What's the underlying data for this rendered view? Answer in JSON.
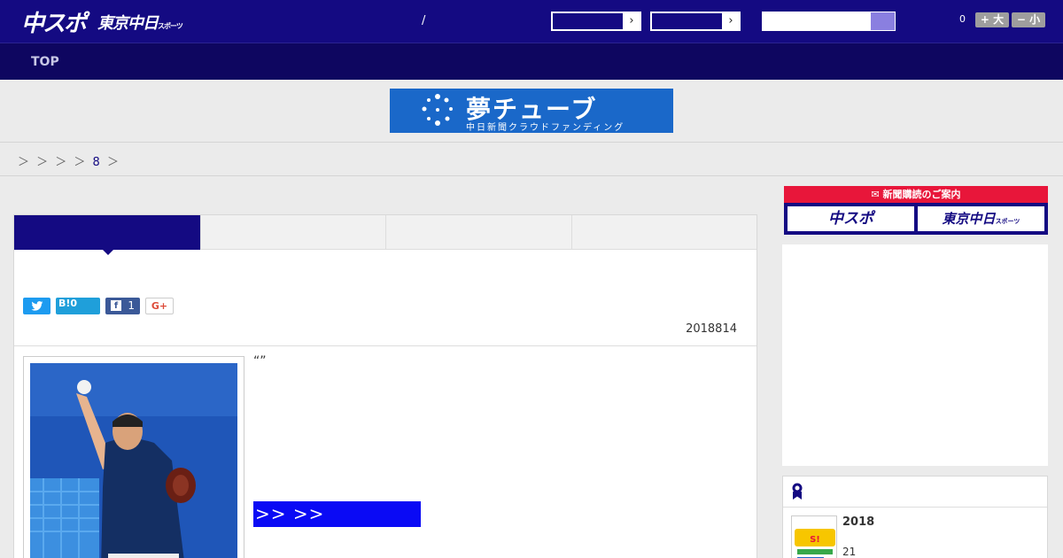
{
  "header": {
    "logo_primary": "中スポ",
    "logo_secondary": "東京中日",
    "logo_secondary_small": "スポーツ",
    "separator": "/",
    "count": "0",
    "font_large": "+ 大",
    "font_small": "− 小",
    "search_placeholder": ""
  },
  "nav": {
    "items": [
      {
        "label": "TOP"
      }
    ]
  },
  "banner": {
    "title": "夢チューブ",
    "subtitle": "中日新聞クラウドファンディング"
  },
  "breadcrumb": {
    "prefix": "＞ ＞ ＞ ＞",
    "link": "8",
    "suffix": "＞"
  },
  "article": {
    "share": {
      "twitter": "t",
      "hatena": "B!0",
      "facebook_count": "1",
      "google": "G+"
    },
    "date": "2018814",
    "quote": "“”",
    "more_link": ">> >>"
  },
  "sidebar": {
    "subscribe_head": "新聞購読のご案内",
    "subscribe_chuspo": "中スポ",
    "subscribe_tokyo": "東京中日",
    "subscribe_tokyo_small": "スポーツ",
    "ranking": {
      "item_title": "2018",
      "item_sub": "21"
    }
  },
  "colors": {
    "header_bg": "#140a82",
    "nav_bg": "#0e0660",
    "accent_red": "#e8163a",
    "link_blue": "#0a0af5"
  }
}
